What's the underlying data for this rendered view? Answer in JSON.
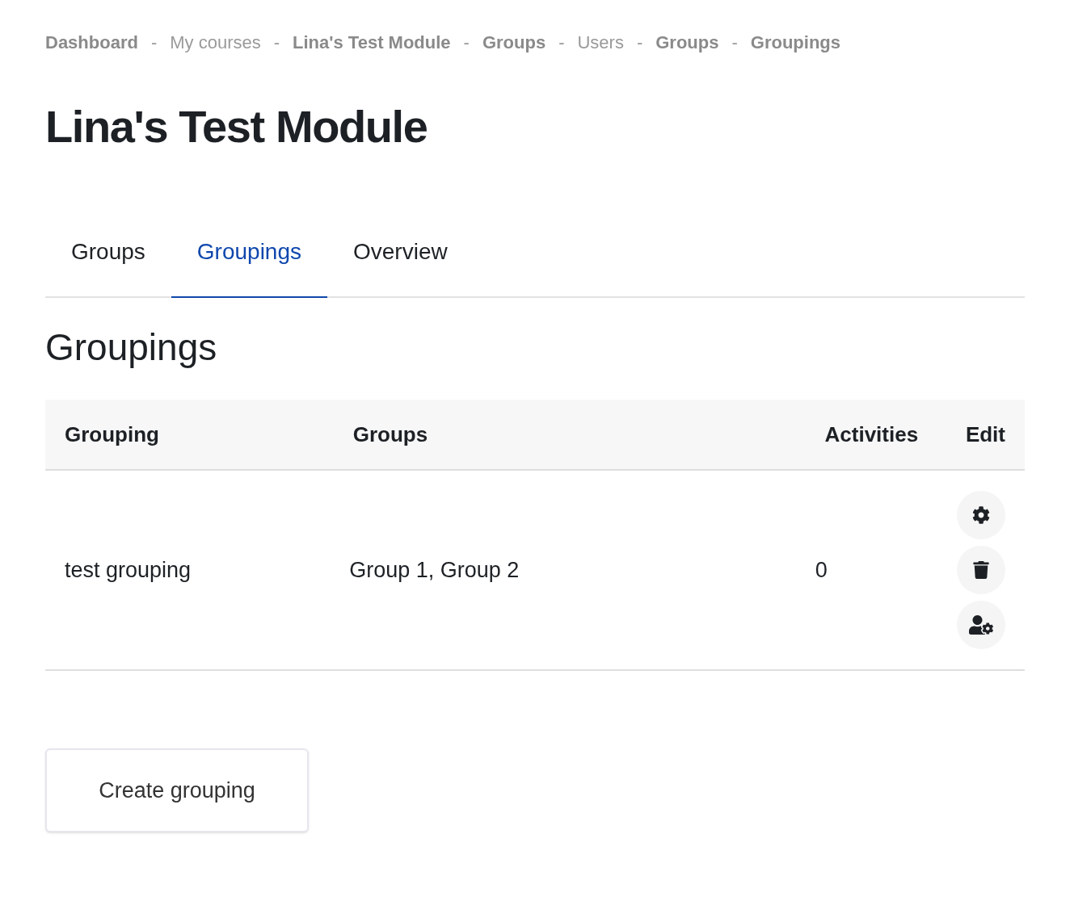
{
  "breadcrumb": [
    {
      "kind": "link",
      "label": "Dashboard"
    },
    {
      "kind": "separator",
      "label": "-"
    },
    {
      "kind": "text",
      "label": "My courses"
    },
    {
      "kind": "separator",
      "label": "-"
    },
    {
      "kind": "link",
      "label": "Lina's Test Module"
    },
    {
      "kind": "separator",
      "label": "-"
    },
    {
      "kind": "link",
      "label": "Groups"
    },
    {
      "kind": "separator",
      "label": "-"
    },
    {
      "kind": "text",
      "label": "Users"
    },
    {
      "kind": "separator",
      "label": "-"
    },
    {
      "kind": "link",
      "label": "Groups"
    },
    {
      "kind": "separator",
      "label": "-"
    },
    {
      "kind": "link",
      "label": "Groupings"
    }
  ],
  "page_title": "Lina's Test Module",
  "tabs": [
    {
      "label": "Groups",
      "selected": false
    },
    {
      "label": "Groupings",
      "selected": true
    },
    {
      "label": "Overview",
      "selected": false
    }
  ],
  "section_heading": "Groupings",
  "table": {
    "columns": [
      "Grouping",
      "Groups",
      "Activities",
      "Edit"
    ],
    "rows": [
      {
        "grouping": "test grouping",
        "groups": "Group 1, Group 2",
        "activities": "0",
        "actions": [
          {
            "kind": "settings"
          },
          {
            "kind": "delete"
          },
          {
            "kind": "members"
          }
        ]
      }
    ]
  },
  "create_button": "Create grouping"
}
